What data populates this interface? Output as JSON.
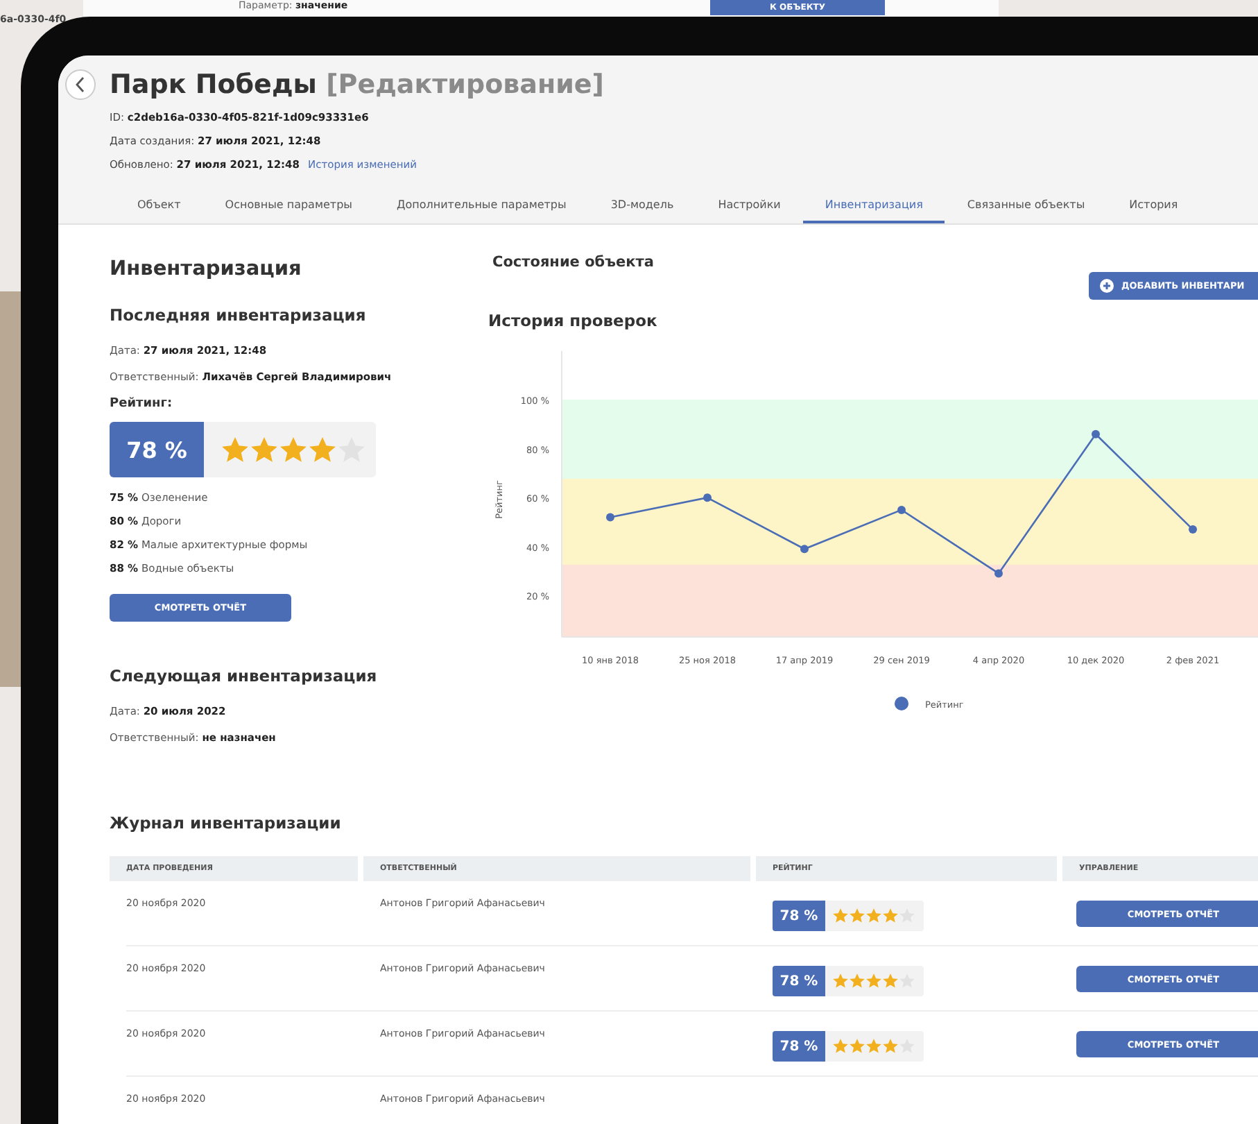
{
  "backdrop": {
    "param_label": "Параметр:",
    "param_value": "значение",
    "button": "К ОБЪЕКТУ",
    "id_fragment": "6a-0330-4f0"
  },
  "header": {
    "title": "Парк Победы",
    "mode": "[Редактирование]",
    "meta": [
      {
        "label": "ID:",
        "value": "c2deb16a-0330-4f05-821f-1d09c93331e6"
      },
      {
        "label": "Дата создания:",
        "value": "27 июля 2021, 12:48"
      },
      {
        "label": "Обновлено:",
        "value": "27 июля 2021, 12:48",
        "link": "История изменений"
      }
    ]
  },
  "tabs": [
    {
      "label": "Объект",
      "selected": false
    },
    {
      "label": "Основные параметры",
      "selected": false
    },
    {
      "label": "Дополнительные параметры",
      "selected": false
    },
    {
      "label": "3D-модель",
      "selected": false
    },
    {
      "label": "Настройки",
      "selected": false
    },
    {
      "label": "Инвентаризация",
      "selected": true
    },
    {
      "label": "Связанные объекты",
      "selected": false
    },
    {
      "label": "История",
      "selected": false
    }
  ],
  "inventory": {
    "title": "Инвентаризация",
    "last": {
      "title": "Последняя инвентаризация",
      "fields": [
        {
          "label": "Дата:",
          "value": "27 июля 2021, 12:48"
        },
        {
          "label": "Ответственный:",
          "value": "Лихачёв Сергей Владимирович"
        }
      ],
      "rating_label": "Рейтинг:",
      "rating": {
        "percent": "78 %",
        "stars": 4
      },
      "breakdown": [
        {
          "percent": "75 %",
          "name": "Озеленение"
        },
        {
          "percent": "80 %",
          "name": "Дороги"
        },
        {
          "percent": "82 %",
          "name": "Малые архитектурные формы"
        },
        {
          "percent": "88 %",
          "name": "Водные объекты"
        }
      ],
      "button": "СМОТРЕТЬ ОТЧЁТ"
    },
    "next": {
      "title": "Следующая инвентаризация",
      "fields": [
        {
          "label": "Дата:",
          "value": "20 июля 2022"
        },
        {
          "label": "Ответственный:",
          "value": "не назначен"
        }
      ]
    }
  },
  "state": {
    "title": "Состояние объекта",
    "add_button": "ДОБАВИТЬ ИНВЕНТАРИ",
    "history_title": "История проверок",
    "chart_data": {
      "type": "line",
      "ylabel": "Рейтинг",
      "categories": [
        "10 янв 2018",
        "25 ноя 2018",
        "17 апр 2019",
        "29 сен 2019",
        "4 апр 2020",
        "10 дек 2020",
        "2 фев 2021"
      ],
      "series": [
        {
          "name": "Рейтинг",
          "color": "#4a6db5",
          "marker": "circle",
          "values": [
            52,
            60,
            39,
            55,
            29,
            86,
            47
          ]
        }
      ],
      "ylim": [
        3,
        120
      ],
      "yticks": [
        {
          "value": 20,
          "label": "20 %"
        },
        {
          "value": 40,
          "label": "40 %"
        },
        {
          "value": 60,
          "label": "60 %"
        },
        {
          "value": 80,
          "label": "80 %"
        },
        {
          "value": 100,
          "label": "100 %"
        }
      ]
    }
  },
  "journal": {
    "title": "Журнал инвентаризации",
    "columns": [
      "ДАТА ПРОВЕДЕНИЯ",
      "ОТВЕТСТВЕННЫЙ",
      "РЕЙТИНГ",
      "УПРАВЛЕНИЕ"
    ],
    "rows": [
      {
        "date": "20 ноября 2020",
        "person": "Антонов Григорий Афанасьевич",
        "percent": "78 %",
        "stars": 4,
        "button": "СМОТРЕТЬ ОТЧЁТ"
      },
      {
        "date": "20 ноября 2020",
        "person": "Антонов Григорий Афанасьевич",
        "percent": "78 %",
        "stars": 4,
        "button": "СМОТРЕТЬ ОТЧЁТ"
      },
      {
        "date": "20 ноября 2020",
        "person": "Антонов Григорий Афанасьевич",
        "percent": "78 %",
        "stars": 4,
        "button": "СМОТРЕТЬ ОТЧЁТ"
      },
      {
        "date": "20 ноября 2020",
        "person": "Антонов Григорий Афанасьевич"
      }
    ]
  }
}
